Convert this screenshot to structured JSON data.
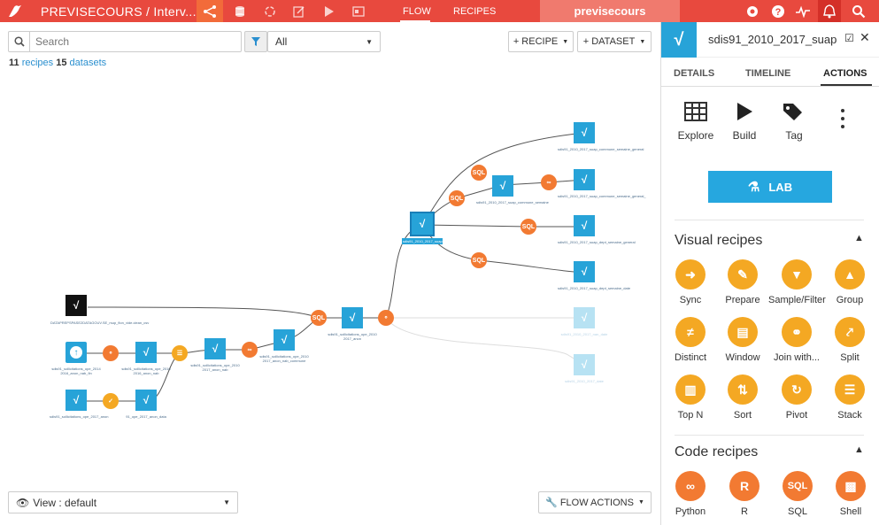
{
  "topbar": {
    "project": "PREVISECOURS / Interv...",
    "nav_flow": "FLOW",
    "nav_recipes": "RECIPES",
    "project_key": "previsecours"
  },
  "toolbar": {
    "search_placeholder": "Search",
    "filter_value": "All",
    "recipe_btn": "+ RECIPE",
    "dataset_btn": "+ DATASET",
    "recipes_count": "11",
    "recipes_label": "recipes",
    "datasets_count": "15",
    "datasets_label": "datasets"
  },
  "bottom": {
    "view_label": "View : default",
    "flow_actions": "FLOW ACTIONS"
  },
  "flow": {
    "labels": [
      "DATAPREPSPASE2DATAGOUV.SE_rsup_flon_vide.clean_csv",
      "sdis91_sollicitations_ope_2014 2016_anon_nab_fin",
      "sdis91_sollicitations_ope_2010 2016_anon_nab",
      "sdis91_sollicitations_ope_2010 2017_anon_nab",
      "sdis91_sollicitations_ope_2010 2017_anon_nab_commune",
      "sdis91_sollicitations_ope_2010 2017_anon",
      "sdis91_sollicitations_ope_2017_anon",
      "91_ope_2017_anon_data",
      "sdis91_2010_2017_suap",
      "sdis91_2010_2017_suap_commune_semaine",
      "sdis91_2010_2017_suap_commune_semaine_general",
      "sdis91_2010_2017_suap_commune_semaine_general_",
      "sdis91_2010_2017_suap_dept_semaine_general",
      "sdis91_2010_2017_suap_dept_semaine_date",
      "sdis91_2010_2017_nan_date",
      "sdis91_2010_2017_date"
    ],
    "sql_label": "SQL"
  },
  "panel": {
    "title": "sdis91_2010_2017_suap",
    "tabs": [
      "DETAILS",
      "TIMELINE",
      "ACTIONS"
    ],
    "actions": [
      "Explore",
      "Build",
      "Tag"
    ],
    "lab_label": "LAB",
    "visual_title": "Visual recipes",
    "visual": [
      "Sync",
      "Prepare",
      "Sample/Filter",
      "Group",
      "Distinct",
      "Window",
      "Join with...",
      "Split",
      "Top N",
      "Sort",
      "Pivot",
      "Stack"
    ],
    "code_title": "Code recipes",
    "code": [
      "Python",
      "R",
      "SQL",
      "Shell"
    ]
  }
}
